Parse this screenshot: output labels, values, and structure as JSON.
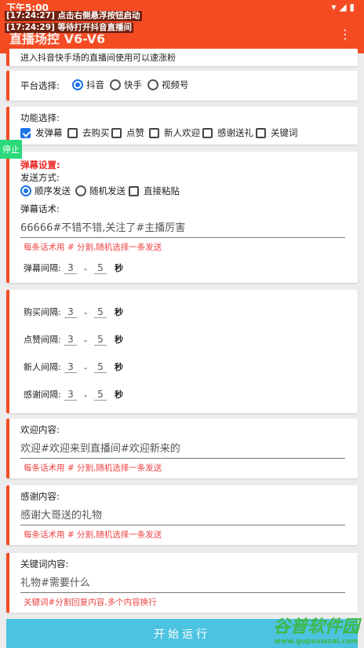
{
  "status": {
    "time": "下午5:00",
    "icons": "▾ ◢ ▮"
  },
  "app": {
    "title": "直播场控 V6-V6",
    "menu_icon": "more-vert-icon"
  },
  "log": [
    "[17:24:27] 点击右侧悬浮按钮启动",
    "[17:24:29] 等待打开抖音直播间"
  ],
  "banner": "进入抖音快手场的直播间使用可以速涨粉",
  "platform": {
    "label": "平台选择:",
    "options": [
      "抖音",
      "快手",
      "视频号"
    ],
    "selected": "抖音"
  },
  "features": {
    "label": "功能选择:",
    "options": [
      "发弹幕",
      "去购买",
      "点赞",
      "新人欢迎",
      "感谢送礼",
      "关键词"
    ],
    "checked": [
      "发弹幕"
    ]
  },
  "stop_button": "停止",
  "danmu": {
    "title": "弹幕设置:",
    "mode_label": "发送方式:",
    "modes": [
      "顺序发送",
      "随机发送"
    ],
    "selected_mode": "顺序发送",
    "paste_label": "直接粘贴",
    "script_label": "弹幕话术:",
    "script_value": "66666#不错不错,关注了#主播厉害",
    "hint": "每条话术用 # 分割,随机选择一条发送",
    "interval": {
      "name": "弹幕间隔:",
      "min": "3",
      "max": "5",
      "unit": "秒"
    }
  },
  "intervals": [
    {
      "name": "购买间隔:",
      "min": "3",
      "max": "5",
      "unit": "秒"
    },
    {
      "name": "点赞间隔:",
      "min": "3",
      "max": "5",
      "unit": "秒"
    },
    {
      "name": "新人间隔:",
      "min": "3",
      "max": "5",
      "unit": "秒"
    },
    {
      "name": "感谢间隔:",
      "min": "3",
      "max": "5",
      "unit": "秒"
    }
  ],
  "welcome": {
    "label": "欢迎内容:",
    "value": "欢迎#欢迎来到直播间#欢迎新来的",
    "hint": "每条话术用 # 分割,随机选择一条发送"
  },
  "thanks": {
    "label": "感谢内容:",
    "value": "感谢大哥送的礼物",
    "hint": "每条话术用 # 分割,随机选择一条发送"
  },
  "keyword": {
    "label": "关键词内容:",
    "value": "礼物#需要什么",
    "hint": "关键词#分割回复内容,多个内容换行"
  },
  "start_button": "开始运行",
  "watermark": {
    "main": "谷普软件园",
    "url": "www.gupuxiazai.com"
  }
}
